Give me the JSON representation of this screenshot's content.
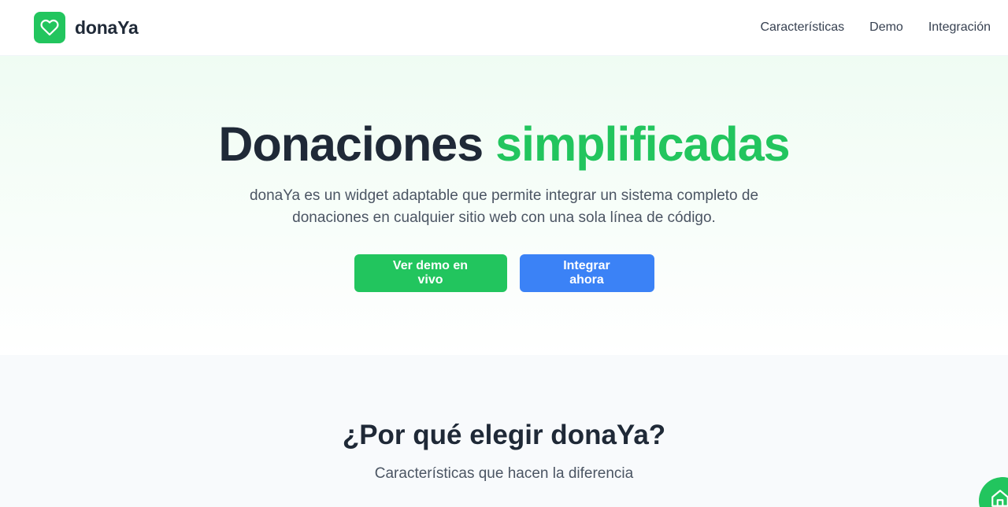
{
  "header": {
    "brand_name": "donaYa",
    "logo_icon": "heart-icon",
    "nav": [
      {
        "label": "Características"
      },
      {
        "label": "Demo"
      },
      {
        "label": "Integración"
      }
    ]
  },
  "hero": {
    "title_main": "Donaciones",
    "title_accent": "simplificadas",
    "subtitle": "donaYa es un widget adaptable que permite integrar un sistema completo de donaciones en cualquier sitio web con una sola línea de código.",
    "primary_button": "Ver demo en vivo",
    "secondary_button": "Integrar ahora"
  },
  "features": {
    "title": "¿Por qué elegir donaYa?",
    "subtitle": "Características que hacen la diferencia"
  },
  "floating_button": {
    "icon": "home-icon"
  },
  "colors": {
    "brand_green": "#22c55e",
    "action_blue": "#3b82f6",
    "text_dark": "#1f2937",
    "text_muted": "#4b5563"
  }
}
